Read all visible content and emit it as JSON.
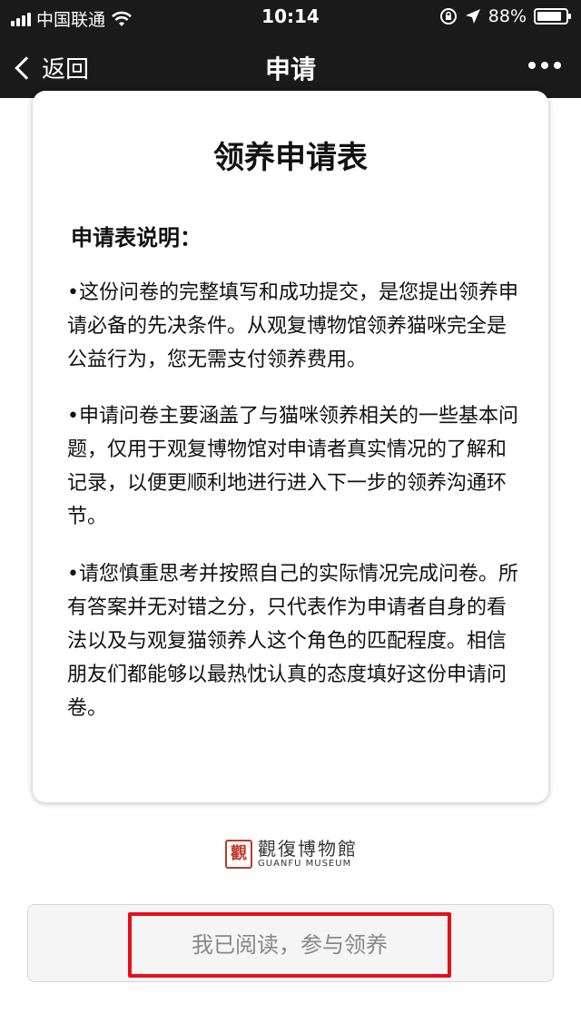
{
  "status_bar": {
    "carrier": "中国联通",
    "time": "10:14",
    "battery": "88%",
    "battery_level": 0.88
  },
  "nav": {
    "back_label": "返回",
    "title": "申请"
  },
  "form": {
    "title": "领养申请表",
    "section_heading": "申请表说明：",
    "paragraphs": [
      "•这份问卷的完整填写和成功提交，是您提出领养申请必备的先决条件。从观复博物馆领养猫咪完全是公益行为，您无需支付领养费用。",
      "•申请问卷主要涵盖了与猫咪领养相关的一些基本问题，仅用于观复博物馆对申请者真实情况的了解和记录，以便更顺利地进行进入下一步的领养沟通环节。",
      "•请您慎重思考并按照自己的实际情况完成问卷。所有答案并无对错之分，只代表作为申请者自身的看法以及与观复猫领养人这个角色的匹配程度。相信朋友们都能够以最热忱认真的态度填好这份申请问卷。"
    ]
  },
  "logo": {
    "name_cn": "觀復博物館",
    "name_en": "GUANFU MUSEUM"
  },
  "action": {
    "button_label": "我已阅读，参与领养"
  },
  "colors": {
    "highlight": "#e3101c",
    "seal": "#c0392b",
    "topbar": "#1a1a1a"
  }
}
